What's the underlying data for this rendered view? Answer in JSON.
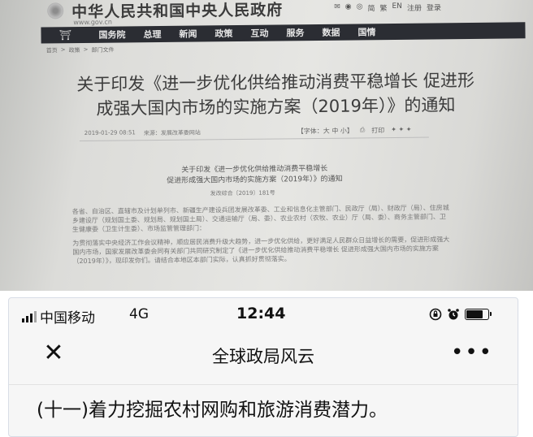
{
  "photo": {
    "site_title": "中华人民共和国中央人民政府",
    "site_url": "www.gov.cn",
    "top_links": [
      "简",
      "繁",
      "EN",
      "注册",
      "登录"
    ],
    "nav_items": [
      "国务院",
      "总理",
      "新闻",
      "政策",
      "互动",
      "服务",
      "数据",
      "国情"
    ],
    "breadcrumb": [
      "首页",
      "政策",
      "部门文件"
    ],
    "title_line1": "关于印发《进一步优化供给推动消费平稳增长 促进形",
    "title_line2": "成强大国内市场的实施方案（2019年）》的通知",
    "meta_date": "2019-01-29 08:51",
    "meta_source": "来源：发展改革委网站",
    "meta_font": "【字体：大 中 小】",
    "meta_print": "打印",
    "sub_title_line1": "关于印发《进一步优化供给推动消费平稳增长",
    "sub_title_line2": "促进形成强大国内市场的实施方案（2019年）》的通知",
    "doc_number": "发改综合〔2019〕181号",
    "body_para1": "各省、自治区、直辖市及计划单列市、新疆生产建设兵团发展改革委、工业和信息化主管部门、民政厅（局）、财政厅（局）、住房城乡建设厅（规划国土委、规划局、规划国土局）、交通运输厅（局、委）、农业农村（农牧、农业）厅（局、委）、商务主管部门、卫生健康委（卫生计生委）、市场监管管理部门：",
    "body_para2": "为贯彻落实中央经济工作会议精神，顺应居民消费升级大趋势，进一步优化供给，更好满足人民群众日益增长的需要，促进形成强大国内市场，国家发展改革委会同有关部门共同研究制定了《进一步优化供给推动消费平稳增长 促进形成强大国内市场的实施方案（2019年）》，现印发你们。请结合本地区本部门实际，认真抓好贯彻落实。"
  },
  "status_bar": {
    "carrier": "中国移动",
    "network": "4G",
    "time": "12:44",
    "battery_level": 0.85
  },
  "nav": {
    "close_icon": "close-icon",
    "title": "全球政局风云",
    "more_icon": "more-icon"
  },
  "content": {
    "first_line": "(十一)着力挖掘农村网购和旅游消费潜力。"
  }
}
